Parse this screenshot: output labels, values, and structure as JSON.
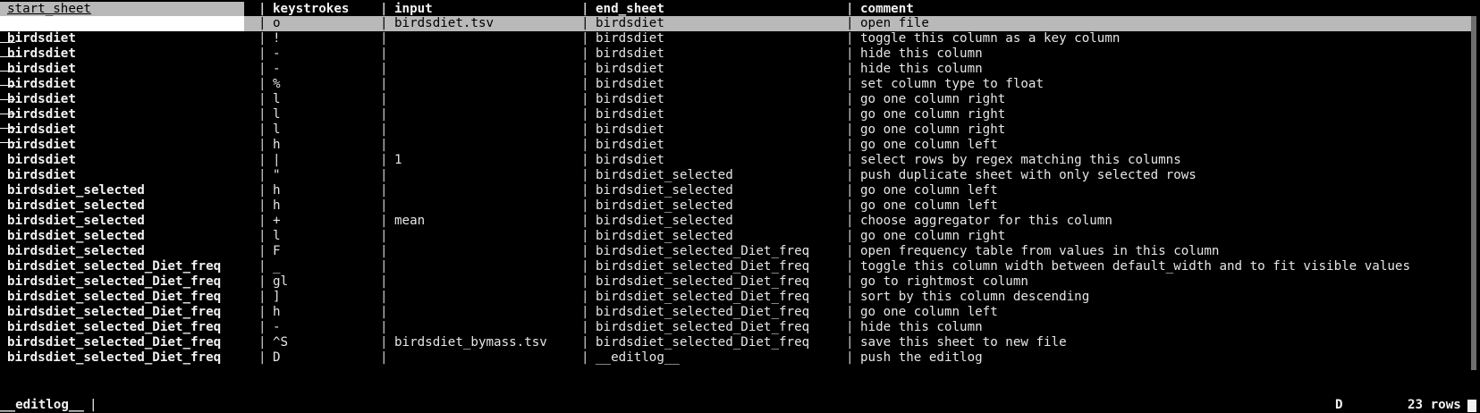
{
  "columns": {
    "start_sheet": "start_sheet",
    "keystrokes": "keystrokes",
    "input": "input",
    "end_sheet": "end_sheet",
    "comment": "comment"
  },
  "separator": "|",
  "rows": [
    {
      "start_sheet": "",
      "keystrokes": "o",
      "input": "birdsdiet.tsv",
      "end_sheet": "birdsdiet",
      "comment": "open file"
    },
    {
      "start_sheet": "birdsdiet",
      "keystrokes": "!",
      "input": "",
      "end_sheet": "birdsdiet",
      "comment": "toggle this column as a key column"
    },
    {
      "start_sheet": "birdsdiet",
      "keystrokes": "-",
      "input": "",
      "end_sheet": "birdsdiet",
      "comment": "hide this column"
    },
    {
      "start_sheet": "birdsdiet",
      "keystrokes": "-",
      "input": "",
      "end_sheet": "birdsdiet",
      "comment": "hide this column"
    },
    {
      "start_sheet": "birdsdiet",
      "keystrokes": "%",
      "input": "",
      "end_sheet": "birdsdiet",
      "comment": "set column type to float"
    },
    {
      "start_sheet": "birdsdiet",
      "keystrokes": "l",
      "input": "",
      "end_sheet": "birdsdiet",
      "comment": "go one column right"
    },
    {
      "start_sheet": "birdsdiet",
      "keystrokes": "l",
      "input": "",
      "end_sheet": "birdsdiet",
      "comment": "go one column right"
    },
    {
      "start_sheet": "birdsdiet",
      "keystrokes": "l",
      "input": "",
      "end_sheet": "birdsdiet",
      "comment": "go one column right"
    },
    {
      "start_sheet": "birdsdiet",
      "keystrokes": "h",
      "input": "",
      "end_sheet": "birdsdiet",
      "comment": "go one column left"
    },
    {
      "start_sheet": "birdsdiet",
      "keystrokes": "|",
      "input": "1",
      "end_sheet": "birdsdiet",
      "comment": "select rows by regex matching this columns"
    },
    {
      "start_sheet": "birdsdiet",
      "keystrokes": "\"",
      "input": "",
      "end_sheet": "birdsdiet_selected",
      "comment": "push duplicate sheet with only selected rows"
    },
    {
      "start_sheet": "birdsdiet_selected",
      "keystrokes": "h",
      "input": "",
      "end_sheet": "birdsdiet_selected",
      "comment": "go one column left"
    },
    {
      "start_sheet": "birdsdiet_selected",
      "keystrokes": "h",
      "input": "",
      "end_sheet": "birdsdiet_selected",
      "comment": "go one column left"
    },
    {
      "start_sheet": "birdsdiet_selected",
      "keystrokes": "+",
      "input": "mean",
      "end_sheet": "birdsdiet_selected",
      "comment": "choose aggregator for this column"
    },
    {
      "start_sheet": "birdsdiet_selected",
      "keystrokes": "l",
      "input": "",
      "end_sheet": "birdsdiet_selected",
      "comment": "go one column right"
    },
    {
      "start_sheet": "birdsdiet_selected",
      "keystrokes": "F",
      "input": "",
      "end_sheet": "birdsdiet_selected_Diet_freq",
      "comment": "open frequency table from values in this column"
    },
    {
      "start_sheet": "birdsdiet_selected_Diet_freq",
      "keystrokes": "_",
      "input": "",
      "end_sheet": "birdsdiet_selected_Diet_freq",
      "comment": "toggle this column width between default_width and to fit visible values"
    },
    {
      "start_sheet": "birdsdiet_selected_Diet_freq",
      "keystrokes": "gl",
      "input": "",
      "end_sheet": "birdsdiet_selected_Diet_freq",
      "comment": "go to rightmost column"
    },
    {
      "start_sheet": "birdsdiet_selected_Diet_freq",
      "keystrokes": "]",
      "input": "",
      "end_sheet": "birdsdiet_selected_Diet_freq",
      "comment": "sort by this column descending"
    },
    {
      "start_sheet": "birdsdiet_selected_Diet_freq",
      "keystrokes": "h",
      "input": "",
      "end_sheet": "birdsdiet_selected_Diet_freq",
      "comment": "go one column left"
    },
    {
      "start_sheet": "birdsdiet_selected_Diet_freq",
      "keystrokes": "-",
      "input": "",
      "end_sheet": "birdsdiet_selected_Diet_freq",
      "comment": "hide this column"
    },
    {
      "start_sheet": "birdsdiet_selected_Diet_freq",
      "keystrokes": "^S",
      "input": "birdsdiet_bymass.tsv",
      "end_sheet": "birdsdiet_selected_Diet_freq",
      "comment": "save this sheet to new file"
    },
    {
      "start_sheet": "birdsdiet_selected_Diet_freq",
      "keystrokes": "D",
      "input": "",
      "end_sheet": "__editlog__",
      "comment": "push the editlog"
    }
  ],
  "status": {
    "sheet_name": "__editlog__",
    "cursor": "|",
    "last_key": "D",
    "row_count": "23 rows"
  },
  "colors": {
    "background": "#000000",
    "foreground": "#e6e6e6",
    "cursor_row": "#b9b9b9"
  }
}
